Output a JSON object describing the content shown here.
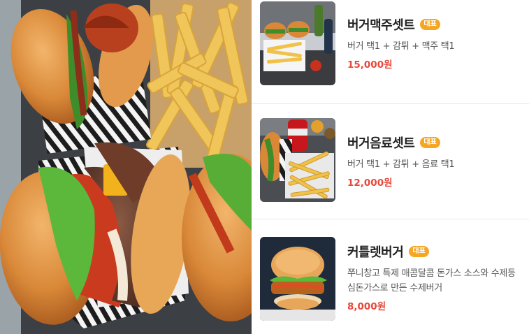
{
  "hero": {
    "image": "burger-hero-photo"
  },
  "menu": {
    "items": [
      {
        "name": "버거맥주셋트",
        "badge": "대표",
        "description": "버거 택1 + 감튀 + 맥주 택1",
        "price": "15,000원",
        "image": "burger-beer-set-photo"
      },
      {
        "name": "버거음료셋트",
        "badge": "대표",
        "description": "버거 택1 + 감튀 + 음료 택1",
        "price": "12,000원",
        "image": "burger-drink-set-photo"
      },
      {
        "name": "커틀렛버거",
        "badge": "대표",
        "description": "쭈니창고 특제 매콤달콤 돈가스 소스와 수제등심돈가스로 만든 수제버거",
        "price": "8,000원",
        "image": "cutlet-burger-photo"
      }
    ]
  },
  "colors": {
    "price": "#e8483b",
    "badge": "#f5a623",
    "name": "#222222",
    "description": "#555555"
  }
}
